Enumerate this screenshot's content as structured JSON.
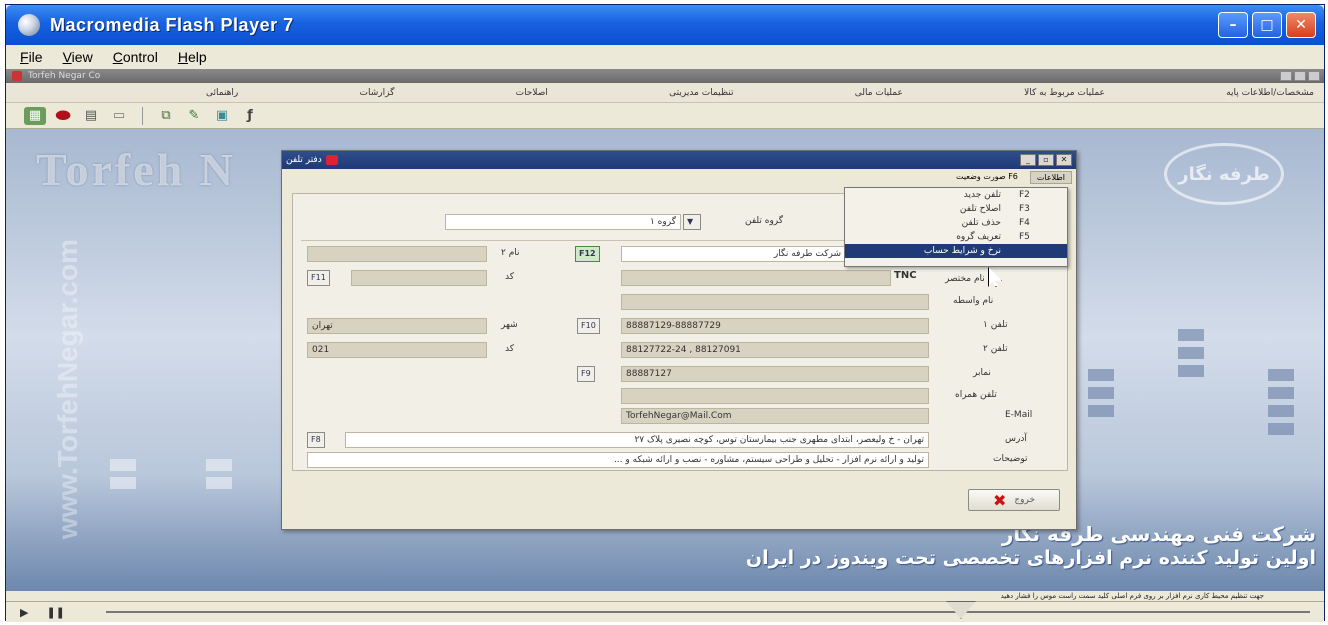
{
  "window": {
    "title": "Macromedia Flash Player 7"
  },
  "menubar": {
    "items": [
      "File",
      "View",
      "Control",
      "Help"
    ]
  },
  "inner": {
    "title": "Torfeh Negar Co",
    "menu": [
      "مشخصات/اطلاعات پایه",
      "عملیات مربوط به کالا",
      "عملیات مالی",
      "تنظیمات مدیریتی",
      "اصلاحات",
      "گزارشات",
      "راهنمائی"
    ]
  },
  "dialog": {
    "title": "دفتر تلفن",
    "menu": [
      "اطلاعات",
      "F6 صورت وضعیت"
    ],
    "search_label": "گروه تلفن",
    "search_value": "گروه ۱",
    "popup": [
      {
        "key": "F2",
        "label": "تلفن جدید"
      },
      {
        "key": "F3",
        "label": "اصلاح تلفن"
      },
      {
        "key": "F4",
        "label": "حذف تلفن"
      },
      {
        "key": "F5",
        "label": "تعریف گروه"
      },
      {
        "key": "",
        "label": "نرخ و شرایط حساب"
      }
    ],
    "fields": {
      "name_value": "شرکت طرفه نگار",
      "f12": "F12",
      "code2_label": "نام ۲",
      "code_label": "کد",
      "f11": "F11",
      "tnc": "TNC",
      "shortcut_label": "نام مختصر",
      "intermediary_label": "نام واسطه",
      "city_label": "شهر",
      "city_value": "تهران",
      "f10": "F10",
      "tel1_label": "تلفن ۱",
      "tel1_value": "88887129-88887729",
      "areacode_label": "کد",
      "areacode_value": "021",
      "tel2_label": "تلفن ۲",
      "tel2_value": "88127722-24 , 88127091",
      "fax_label": "نمابر",
      "f9": "F9",
      "fax_value": "88887127",
      "mobile_label": "تلفن همراه",
      "email_label": "E-Mail",
      "email_value": "TorfehNegar@Mail.Com",
      "address_label": "آدرس",
      "address_value": "تهران - خ ولیعصر، ابتدای مطهری جنب بیمارستان توس، کوچه نصیری پلاک ۲۷",
      "f8": "F8",
      "desc_label": "توضیحات",
      "desc_value": "تولید و ارائه نرم افزار - تحلیل و طراحی سیستم، مشاوره - نصب و ارائه شبکه و ..."
    },
    "exit_label": "خروج"
  },
  "desktop": {
    "brand": "Torfeh N",
    "vertical": "www.TorfehNegar.com",
    "logo": "طرفه نگار",
    "tagline1": "شرکت فنی مهندسی طرفه نگار",
    "tagline2": "اولین تولید کننده نرم افزارهای تخصصی تحت ویندوز در ایران"
  },
  "hint": "جهت تنظیم محیط کاری نرم افزار بر روی فرم اصلی کلید سمت راست موس را فشار دهید"
}
